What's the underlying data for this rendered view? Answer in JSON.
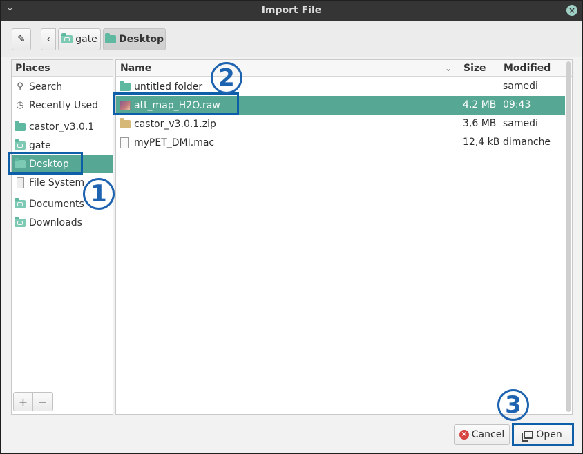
{
  "window": {
    "title": "Import File"
  },
  "toolbar": {
    "crumbs": [
      "gate",
      "Desktop"
    ]
  },
  "sidebar": {
    "header": "Places",
    "items": [
      {
        "label": "Search",
        "icon": "search-icon"
      },
      {
        "label": "Recently Used",
        "icon": "clock-icon"
      },
      {
        "label": "castor_v3.0.1",
        "icon": "folder-icon"
      },
      {
        "label": "gate",
        "icon": "folder-icon"
      },
      {
        "label": "Desktop",
        "icon": "folder-icon",
        "selected": true
      },
      {
        "label": "File System",
        "icon": "drive-icon"
      },
      {
        "label": "Documents",
        "icon": "folder-icon"
      },
      {
        "label": "Downloads",
        "icon": "folder-icon"
      }
    ],
    "add_label": "+",
    "remove_label": "−"
  },
  "filelist": {
    "columns": {
      "name": "Name",
      "size": "Size",
      "modified": "Modified"
    },
    "rows": [
      {
        "name": "untitled folder",
        "size": "",
        "modified": "samedi",
        "icon": "folder-icon"
      },
      {
        "name": "att_map_H2O.raw",
        "size": "4,2 MB",
        "modified": "09:43",
        "icon": "image-icon",
        "selected": true
      },
      {
        "name": "castor_v3.0.1.zip",
        "size": "3,6 MB",
        "modified": "samedi",
        "icon": "archive-icon"
      },
      {
        "name": "myPET_DMI.mac",
        "size": "12,4 kB",
        "modified": "dimanche",
        "icon": "text-file-icon"
      }
    ]
  },
  "annotations": {
    "step1": "1",
    "step2": "2",
    "step3": "3"
  },
  "buttons": {
    "cancel": "Cancel",
    "open": "Open"
  },
  "colors": {
    "accent": "#56a793",
    "annotation": "#0f5ea8",
    "titlebar": "#353535"
  }
}
